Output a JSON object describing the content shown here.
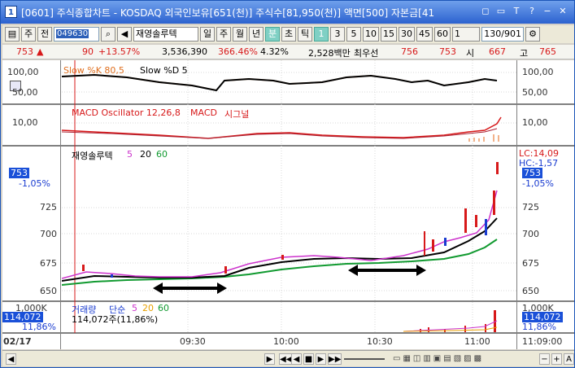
{
  "window": {
    "title": "[0601] 주식종합차트 - KOSDAQ 외국인보유[651(천)] 주식수[81,950(천)] 액면[500] 자본금[41",
    "icon": "1",
    "buttons": [
      "◻",
      "▭",
      "T",
      "?",
      "−",
      "✕"
    ]
  },
  "toolbar": {
    "type_select": "주",
    "range_label": "전",
    "code_value": "049630",
    "name_value": "재영솔루텍",
    "periods": [
      "일",
      "주",
      "월",
      "년",
      "분",
      "초",
      "틱"
    ],
    "active_period": "분",
    "intervals": [
      "1",
      "3",
      "5",
      "10",
      "15",
      "30",
      "45",
      "60"
    ],
    "active_interval": "1",
    "interval_select": "1",
    "page_value": "130/901"
  },
  "quote": {
    "price": "753",
    "arrow": "▲",
    "change": "90",
    "change_pct": "+13.57%",
    "volume": "3,536,390",
    "vol_ratio": "366.46%",
    "turnover": "4.32%",
    "amount": "2,528백만",
    "pref_label": "최우선",
    "pref_ask": "756",
    "pref_bid": "753",
    "open_label": "시",
    "open": "667",
    "high_label": "고",
    "high": "765"
  },
  "panels": {
    "stoch": {
      "title_a": "Slow %K 80,5",
      "title_b": "Slow %D 5",
      "ticks": [
        "100,00",
        "50,00"
      ]
    },
    "macd": {
      "title_a": "MACD Oscillator 12,26,8",
      "title_b": "MACD",
      "title_c": "시그널",
      "ticks": [
        "10,00"
      ]
    },
    "price": {
      "title": "재영솔루텍",
      "ma": [
        "5",
        "20",
        "60"
      ],
      "ticks": [
        "725",
        "700",
        "675",
        "650"
      ],
      "current": "753",
      "current_pct": "-1,05%",
      "lc": "LC:14,09",
      "hc": "HC:-1,57"
    },
    "volume": {
      "title_a": "거래량",
      "title_b": "단순",
      "ma": [
        "5",
        "20",
        "60"
      ],
      "summary": "114,072주(11,86%)",
      "scale": "1,000K",
      "current": "114,072",
      "current_pct": "11,86%"
    }
  },
  "time_axis": {
    "date": "02/17",
    "labels": [
      "09:30",
      "10:00",
      "10:30",
      "11:00"
    ],
    "cursor_time": "11:09:00"
  },
  "scroll": {
    "buttons": [
      "◀",
      "▶",
      "◀◀",
      "◀",
      "■",
      "▶",
      "▶▶",
      "−",
      "+",
      "A"
    ]
  },
  "colors": {
    "accent": "#1a50d8",
    "up": "#d7191a",
    "down": "#1a3cd0",
    "ma20": "#000000",
    "ma60": "#119a30",
    "ma5": "#cc33cc"
  }
}
